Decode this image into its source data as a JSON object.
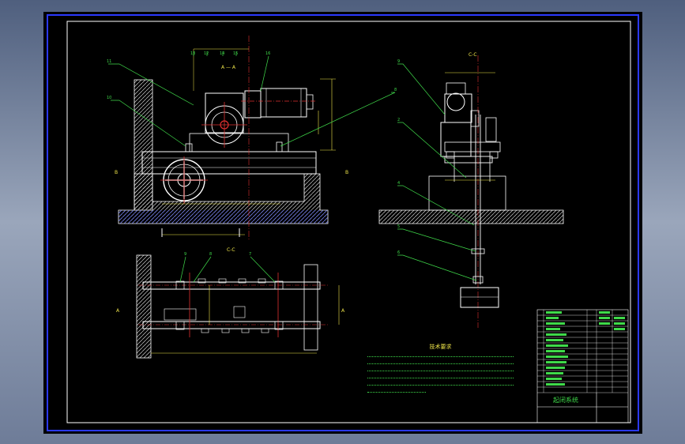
{
  "drawing": {
    "view_labels": [
      "A — A",
      "C-C",
      "C-C"
    ],
    "section_markers": [
      "B",
      "B",
      "A",
      "A"
    ],
    "title_block": {
      "name": "起闭系统"
    },
    "technical_notes_title": "技术要求"
  },
  "colors": {
    "background": "#000000",
    "outline_white": "#ffffff",
    "leader_green": "#3fd94a",
    "dimension_yellow": "#f0e64a",
    "center_red": "#e03030",
    "border_blue": "#2b39ff"
  }
}
